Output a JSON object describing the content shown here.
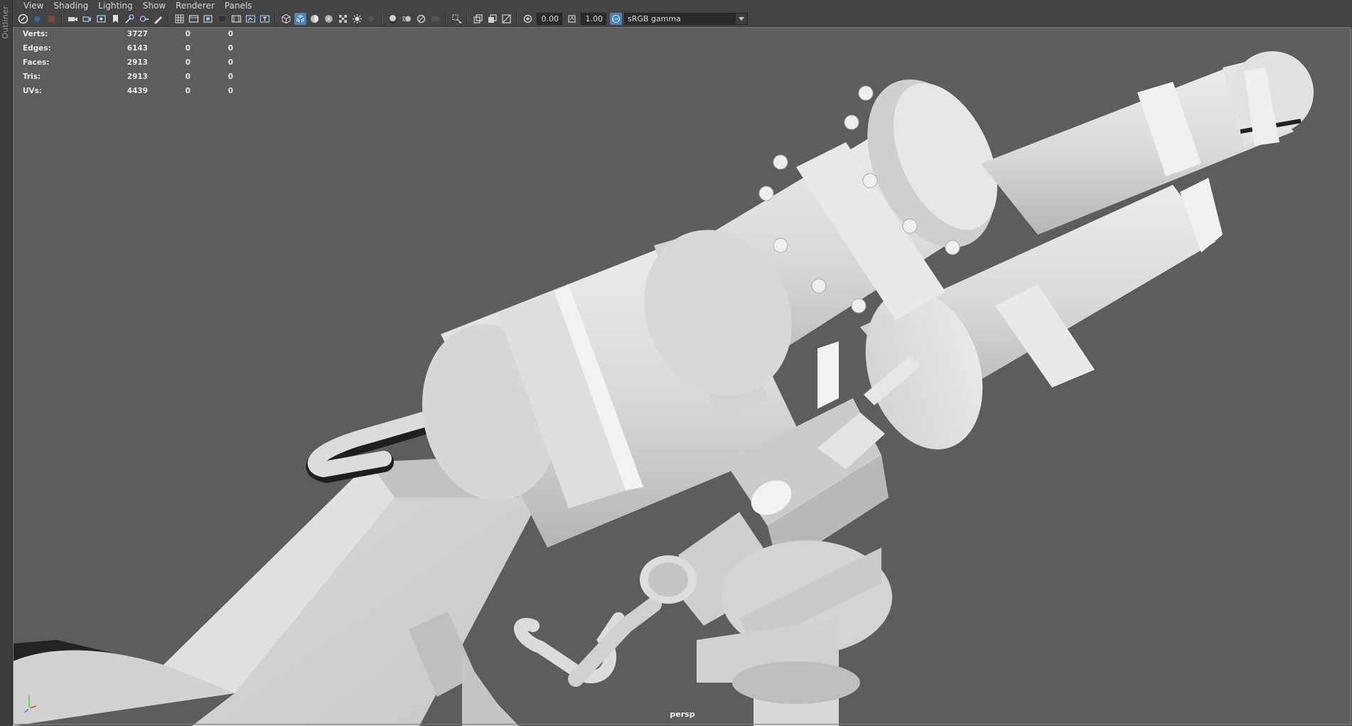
{
  "outliner": {
    "label": "Outliner"
  },
  "menubar": {
    "items": [
      "View",
      "Shading",
      "Lighting",
      "Show",
      "Renderer",
      "Panels"
    ]
  },
  "toolbar": {
    "exposure_value": "0.00",
    "gamma_value": "1.00",
    "color_space": "sRGB gamma",
    "icons": [
      "select-camera-icon",
      "camera-attributes-icon",
      "bookmarks-icon",
      "image-plane-icon",
      "grid-icon",
      "film-gate-icon",
      "resolution-gate-icon",
      "gate-mask-icon",
      "field-chart-icon",
      "safe-action-icon",
      "safe-title-icon",
      "wireframe-icon",
      "smooth-shade-icon",
      "shaded-wireframe-icon",
      "textured-icon",
      "use-lights-icon",
      "shadows-icon",
      "ambient-occlusion-icon",
      "motion-blur-icon",
      "anti-aliasing-icon",
      "depth-of-field-icon",
      "isolate-select-icon",
      "xray-icon",
      "xray-joints-icon",
      "backface-icon",
      "exposure-icon",
      "gamma-icon",
      "color-management-icon"
    ]
  },
  "hud": {
    "rows": [
      {
        "label": "Verts:",
        "v1": "3727",
        "v2": "0",
        "v3": "0"
      },
      {
        "label": "Edges:",
        "v1": "6143",
        "v2": "0",
        "v3": "0"
      },
      {
        "label": "Faces:",
        "v1": "2913",
        "v2": "0",
        "v3": "0"
      },
      {
        "label": "Tris:",
        "v1": "2913",
        "v2": "0",
        "v3": "0"
      },
      {
        "label": "UVs:",
        "v1": "4439",
        "v2": "0",
        "v3": "0"
      }
    ]
  },
  "viewport": {
    "camera": "persp",
    "background_color": "#5d5d5d",
    "model_color": "#d0d0d0"
  }
}
